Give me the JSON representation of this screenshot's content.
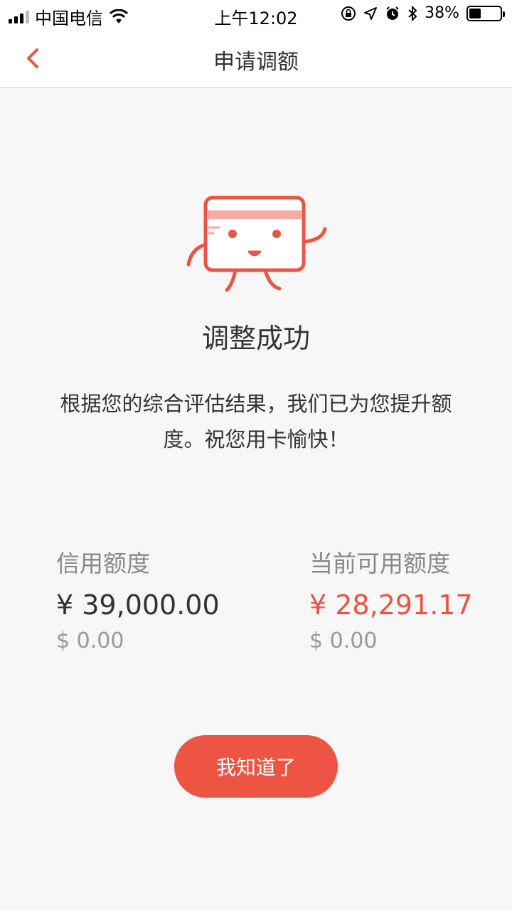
{
  "status_bar": {
    "carrier": "中国电信",
    "time": "上午12:02",
    "battery_percent": "38%",
    "battery_level": 0.38,
    "icons": [
      "signal-icon",
      "wifi-icon",
      "orientation-lock-icon",
      "location-icon",
      "alarm-icon",
      "bluetooth-icon",
      "battery-icon"
    ]
  },
  "nav": {
    "title": "申请调额",
    "back_icon": "chevron-left-icon"
  },
  "result": {
    "icon": "credit-card-mascot-icon",
    "title": "调整成功",
    "description": "根据您的综合评估结果，我们已为您提升额度。祝您用卡愉快！"
  },
  "limits": {
    "credit": {
      "label": "信用额度",
      "cny": "¥ 39,000.00",
      "usd": "$ 0.00"
    },
    "available": {
      "label": "当前可用额度",
      "cny": "¥ 28,291.17",
      "usd": "$ 0.00"
    }
  },
  "actions": {
    "confirm_label": "我知道了"
  },
  "colors": {
    "accent": "#ee5444",
    "amount_highlight": "#ea5444",
    "background": "#f7f7f7"
  }
}
